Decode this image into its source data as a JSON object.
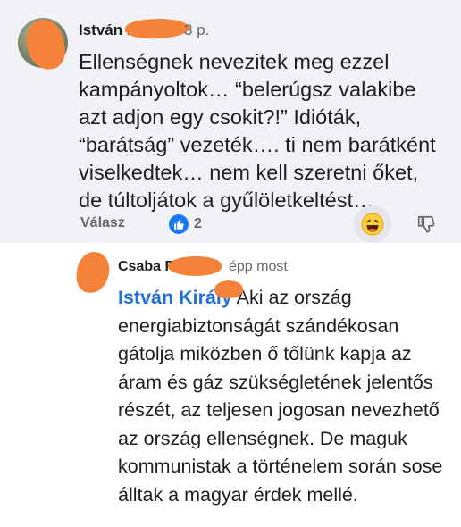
{
  "comment1": {
    "author": "István K",
    "time": "3 p.",
    "text": "Ellenségnek nevezitek meg ezzel kampányoltok… “belerúgsz valakibe azt adjon egy csokit?!” Idióták, “barátság” vezeték…. ti nem barátként viselkedtek… nem kell szeretni őket, de túltoljátok a gyűlöletkeltést…",
    "reply_label": "Válasz",
    "like_count": "2"
  },
  "comment2": {
    "author": "Csaba F",
    "time": "épp most",
    "mention": "István Király",
    "text": " Aki az ország energiabiztonságát szándékosan gátolja miközben ő tőlünk kapja az áram és gáz szükségletének jelentős részét, az teljesen jogosan nevezhető az ország ellenségnek. De maguk kommunistak a történelem során sose álltak a magyar érdek mellé."
  },
  "colors": {
    "comment_bg": "#f0f2f5",
    "link_blue": "#216fdb",
    "like_blue": "#1877f2",
    "muted": "#65676b",
    "redaction": "#f5823a"
  },
  "icons": {
    "like": "thumbs-up-icon",
    "haha": "laughing-emoji-icon",
    "dislike": "thumbs-down-icon"
  }
}
